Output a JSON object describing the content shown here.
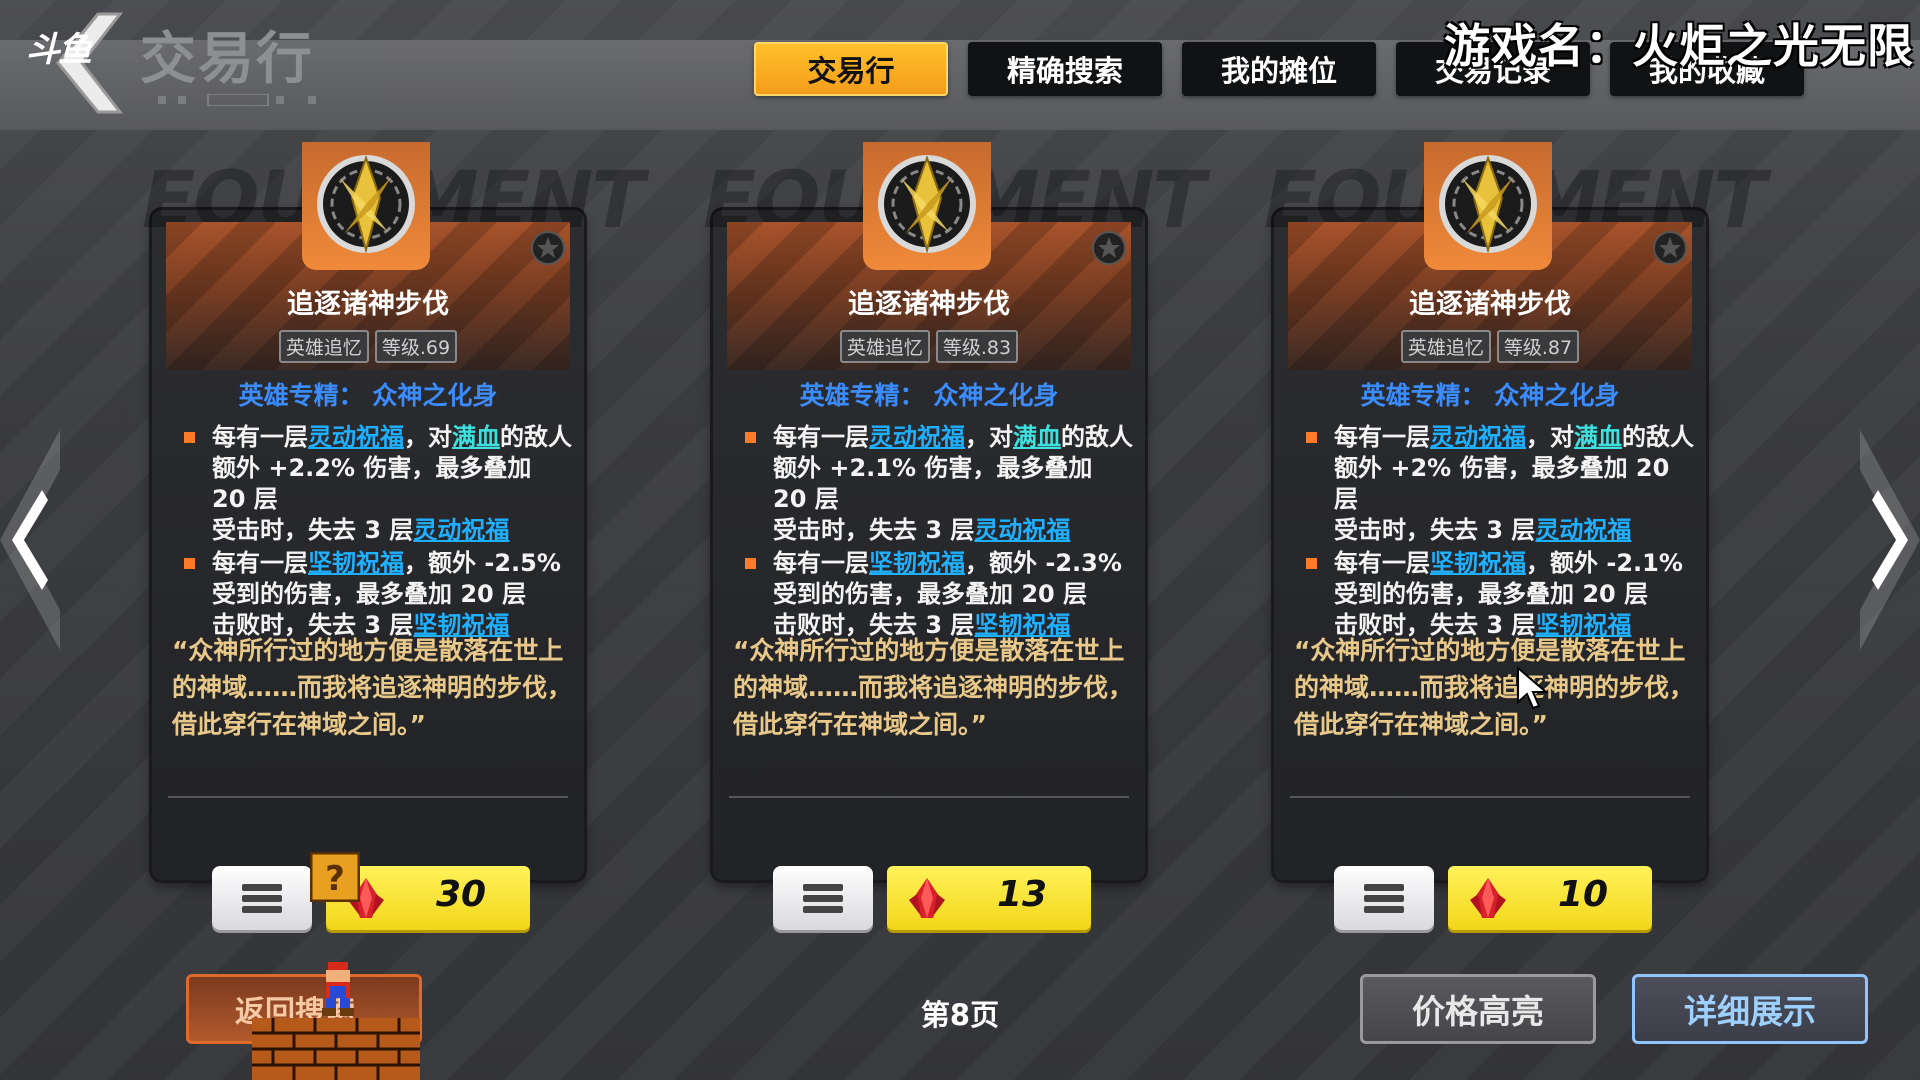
{
  "header": {
    "corner_logo": "斗鱼",
    "title": "交易行",
    "watermark": "游戏名：火炬之光无限"
  },
  "tabs": [
    {
      "label": "交易行",
      "active": true
    },
    {
      "label": "精确搜索",
      "active": false
    },
    {
      "label": "我的摊位",
      "active": false
    },
    {
      "label": "交易记录",
      "active": false
    },
    {
      "label": "我的收藏",
      "active": false
    }
  ],
  "cards": [
    {
      "bg_word": "EQUIPMENT",
      "name": "追逐诸神步伐",
      "tag_type": "英雄追忆",
      "tag_level": "等级.69",
      "spec_label": "英雄专精：",
      "spec_value": "众神之化身",
      "b1_p1": "每有一层",
      "b1_k1": "灵动祝福",
      "b1_p2": "，对",
      "b1_k2": "满血",
      "b1_p3": "的敌人额外 +2.2% 伤害，最多叠加 20 层",
      "b1_p4": "受击时，失去 3 层",
      "b1_k3": "灵动祝福",
      "b2_p1": "每有一层",
      "b2_k1": "坚韧祝福",
      "b2_p2": "，额外 -2.5% 受到的伤害，最多叠加 20 层",
      "b2_p3": "击败时，失去 3 层",
      "b2_k2": "坚韧祝福",
      "quote": "“众神所行过的地方便是散落在世上的神域……而我将追逐神明的步伐，借此穿行在神域之间。”",
      "price": "30"
    },
    {
      "bg_word": "EQUIPMENT",
      "name": "追逐诸神步伐",
      "tag_type": "英雄追忆",
      "tag_level": "等级.83",
      "spec_label": "英雄专精：",
      "spec_value": "众神之化身",
      "b1_p1": "每有一层",
      "b1_k1": "灵动祝福",
      "b1_p2": "，对",
      "b1_k2": "满血",
      "b1_p3": "的敌人额外 +2.1% 伤害，最多叠加 20 层",
      "b1_p4": "受击时，失去 3 层",
      "b1_k3": "灵动祝福",
      "b2_p1": "每有一层",
      "b2_k1": "坚韧祝福",
      "b2_p2": "，额外 -2.3% 受到的伤害，最多叠加 20 层",
      "b2_p3": "击败时，失去 3 层",
      "b2_k2": "坚韧祝福",
      "quote": "“众神所行过的地方便是散落在世上的神域……而我将追逐神明的步伐，借此穿行在神域之间。”",
      "price": "13"
    },
    {
      "bg_word": "EQUIPMENT",
      "name": "追逐诸神步伐",
      "tag_type": "英雄追忆",
      "tag_level": "等级.87",
      "spec_label": "英雄专精：",
      "spec_value": "众神之化身",
      "b1_p1": "每有一层",
      "b1_k1": "灵动祝福",
      "b1_p2": "，对",
      "b1_k2": "满血",
      "b1_p3": "的敌人额外 +2% 伤害，最多叠加 20 层",
      "b1_p4": "受击时，失去 3 层",
      "b1_k3": "灵动祝福",
      "b2_p1": "每有一层",
      "b2_k1": "坚韧祝福",
      "b2_p2": "，额外 -2.1% 受到的伤害，最多叠加 20 层",
      "b2_p3": "击败时，失去 3 层",
      "b2_k2": "坚韧祝福",
      "quote": "“众神所行过的地方便是散落在世上的神域……而我将追逐神明的步伐，借此穿行在神域之间。”",
      "price": "10"
    }
  ],
  "footer": {
    "back_label": "返回搜索",
    "page_label": "第8页",
    "price_highlight_label": "价格高亮",
    "detail_label": "详细展示"
  },
  "colors": {
    "active_tab": "#f7a91f",
    "price_bg": "#f5e02a",
    "keyword_blue": "#1fb0ff",
    "keyword_cyan": "#3fe0e0",
    "quote_gold": "#e9c98a"
  },
  "icons": {
    "back": "back-chevron-icon",
    "card_item": "gold-crest-icon",
    "favorite": "star-icon",
    "menu": "menu-lines-icon",
    "currency": "red-crystal-icon",
    "prev": "left-arrow-icon",
    "next": "right-arrow-icon"
  }
}
